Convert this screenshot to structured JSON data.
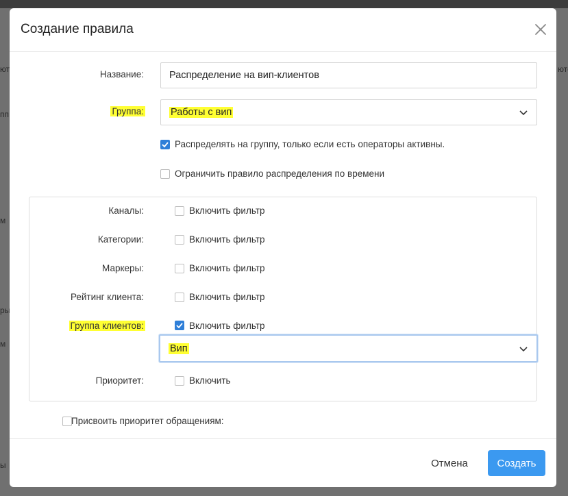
{
  "background": {
    "fragments": [
      "юто",
      "ются",
      "пп",
      "м",
      "ры",
      "м",
      "ы"
    ]
  },
  "modal": {
    "title": "Создание правила",
    "close_label": "×"
  },
  "form": {
    "name_label": "Название:",
    "name_value": "Распределение на вип-клиентов",
    "group_label": "Группа:",
    "group_value": "Работы с вип",
    "distribute_active_label": "Распределять на группу, только если есть операторы активны.",
    "distribute_active_checked": true,
    "limit_time_label": "Ограничить правило распределения по времени",
    "limit_time_checked": false
  },
  "filters": {
    "channels_label": "Каналы:",
    "categories_label": "Категории:",
    "markers_label": "Маркеры:",
    "rating_label": "Рейтинг клиента:",
    "client_group_label": "Группа клиентов:",
    "enable_filter_label": "Включить фильтр",
    "client_group_value": "Вип",
    "priority_label": "Приоритет:",
    "priority_enable_label": "Включить"
  },
  "assign_priority_label": "Присвоить приоритет обращениям:",
  "footer": {
    "cancel_label": "Отмена",
    "create_label": "Создать"
  },
  "colors": {
    "accent": "#3b99f0",
    "checkbox_checked": "#2f7fd8",
    "highlight": "#ffff33"
  }
}
